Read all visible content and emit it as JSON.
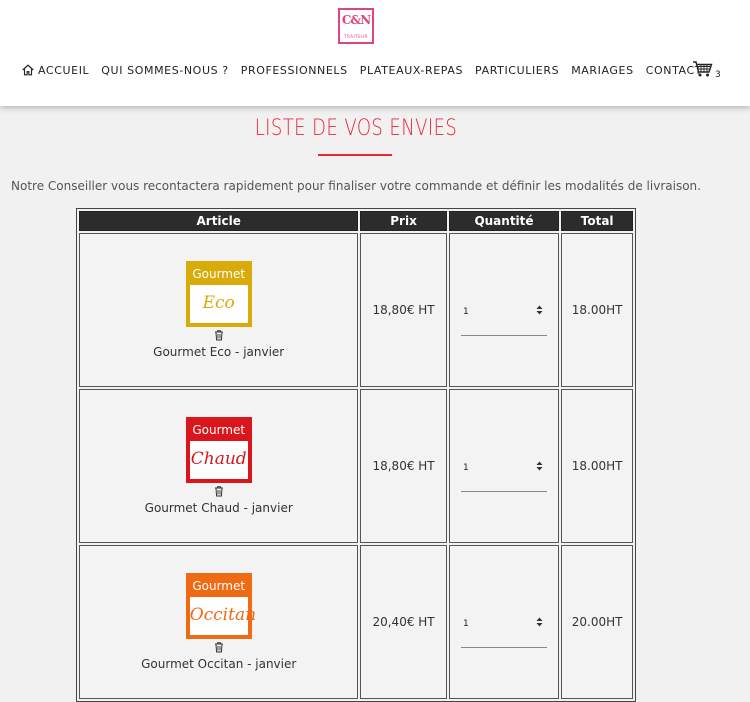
{
  "header": {
    "logo_text": "C&N",
    "logo_sub": "TRAITEUR",
    "nav": [
      {
        "label": "ACCUEIL",
        "icon": "home-icon"
      },
      {
        "label": "QUI SOMMES-NOUS ?"
      },
      {
        "label": "PROFESSIONNELS"
      },
      {
        "label": "PLATEAUX-REPAS"
      },
      {
        "label": "PARTICULIERS"
      },
      {
        "label": "MARIAGES"
      },
      {
        "label": "CONTACT"
      }
    ],
    "cart": {
      "icon": "cart-icon",
      "count": "3"
    }
  },
  "page": {
    "title": "LISTE DE VOS ENVIES",
    "intro": "Notre Conseiller vous recontactera rapidement pour finaliser votre commande et définir les modalités de livraison."
  },
  "table": {
    "headers": [
      "Article",
      "Prix",
      "Quantité",
      "Total"
    ],
    "rows": [
      {
        "brand": "Gourmet",
        "variant": "Eco",
        "name": "Gourmet Eco - janvier",
        "price": "18,80€ HT",
        "qty": "1",
        "total": "18.00HT",
        "color": "#d9ab0a",
        "script_color": "#d9ab0a"
      },
      {
        "brand": "Gourmet",
        "variant": "Chaud",
        "name": "Gourmet Chaud - janvier",
        "price": "18,80€ HT",
        "qty": "1",
        "total": "18.00HT",
        "color": "#d9161c",
        "script_color": "#d9161c"
      },
      {
        "brand": "Gourmet",
        "variant": "Occitan",
        "name": "Gourmet Occitan - janvier",
        "price": "20,40€ HT",
        "qty": "1",
        "total": "20.00HT",
        "color": "#f06a14",
        "script_color": "#f06a14"
      }
    ]
  },
  "colors": {
    "accent": "#e8263a",
    "header_bg": "#2c2c2c"
  }
}
